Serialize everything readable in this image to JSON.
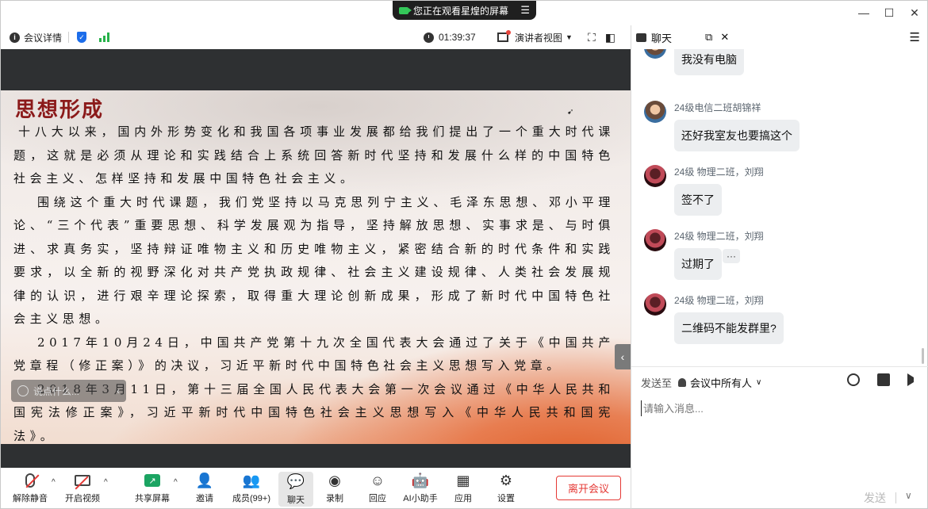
{
  "window": {
    "share_banner": "您正在观看星煌的屏幕",
    "controls": [
      "—",
      "☐",
      "✕"
    ]
  },
  "topbar": {
    "meeting_info": "会议详情",
    "timer": "01:39:37",
    "view_mode": "演讲者视图"
  },
  "slide": {
    "title": "思想形成",
    "paragraphs": [
      "十八大以来，国内外形势变化和我国各项事业发展都给我们提出了一个重大时代课题，这就是必须从理论和实践结合上系统回答新时代坚持和发展什么样的中国特色社会主义、怎样坚持和发展中国特色社会主义。",
      "围绕这个重大时代课题，我们党坚持以马克思列宁主义、毛泽东思想、邓小平理论、“三个代表”重要思想、科学发展观为指导，坚持解放思想、实事求是、与时俱进、求真务实，坚持辩证唯物主义和历史唯物主义，紧密结合新的时代条件和实践要求，以全新的视野深化对共产党执政规律、社会主义建设规律、人类社会发展规律的认识，进行艰辛理论探索，取得重大理论创新成果，形成了新时代中国特色社会主义思想。",
      "2017年10月24日，中国共产党第十九次全国代表大会通过了关于《中国共产党章程（修正案）》的决议，习近平新时代中国特色社会主义思想写入党章。",
      "2018年3月11日，第十三届全国人民代表大会第一次会议通过《中华人民共和国宪法修正案》，习近平新时代中国特色社会主义思想写入《中华人民共和国宪法》。"
    ],
    "quick_input_placeholder": "说点什么..."
  },
  "toolbar": {
    "mute": "解除静音",
    "video": "开启视频",
    "share": "共享屏幕",
    "invite": "邀请",
    "members": "成员(99+)",
    "chat": "聊天",
    "record": "录制",
    "react": "回应",
    "ai": "AI小助手",
    "apps": "应用",
    "settings": "设置",
    "leave": "离开会议"
  },
  "chat": {
    "title": "聊天",
    "messages": [
      {
        "sender": "",
        "text": "我没有电脑",
        "avatar": "avatar-a"
      },
      {
        "sender": "24级电信二班胡锦祥",
        "text": "还好我室友也要搞这个",
        "avatar": "avatar-a"
      },
      {
        "sender": "24级 物理二班，刘翔",
        "text": "签不了",
        "avatar": "avatar-b"
      },
      {
        "sender": "24级 物理二班，刘翔",
        "text": "过期了",
        "avatar": "avatar-b"
      },
      {
        "sender": "24级 物理二班，刘翔",
        "text": "二维码不能发群里?",
        "avatar": "avatar-b"
      }
    ],
    "more_label": "···",
    "send_to_label": "发送至",
    "send_to_target": "会议中所有人",
    "input_placeholder": "请输入消息...",
    "send_label": "发送"
  }
}
